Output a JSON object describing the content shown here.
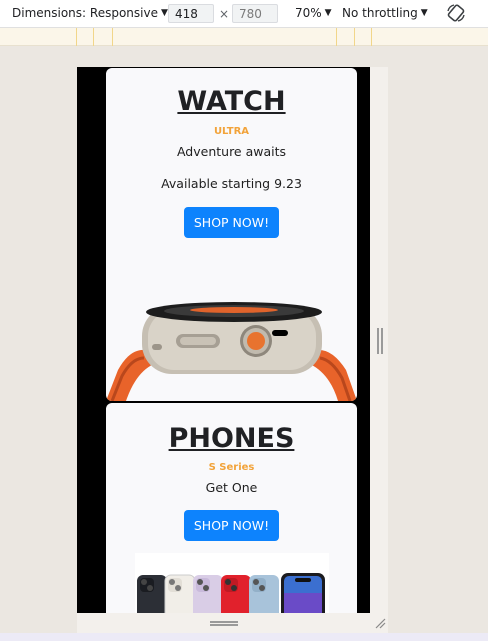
{
  "devtools": {
    "dimensions_label": "Dimensions: Responsive",
    "width_value": "418",
    "height_value": "780",
    "zoom_label": "70%",
    "throttling_label": "No throttling",
    "rotate_icon": "rotate-icon"
  },
  "site": {
    "watch": {
      "title": "WATCH",
      "subtitle": "ULTRA",
      "tagline": "Adventure awaits",
      "availability": "Available starting 9.23",
      "button_label": "SHOP NOW!"
    },
    "phones": {
      "title": "PHONES",
      "subtitle": "S Series",
      "tagline": "Get One",
      "button_label": "SHOP NOW!"
    }
  },
  "colors": {
    "accent_button": "#0d83fd",
    "subtitle_orange": "#f2a33a",
    "device_background": "#000000",
    "card_background": "#f9f9fb"
  }
}
